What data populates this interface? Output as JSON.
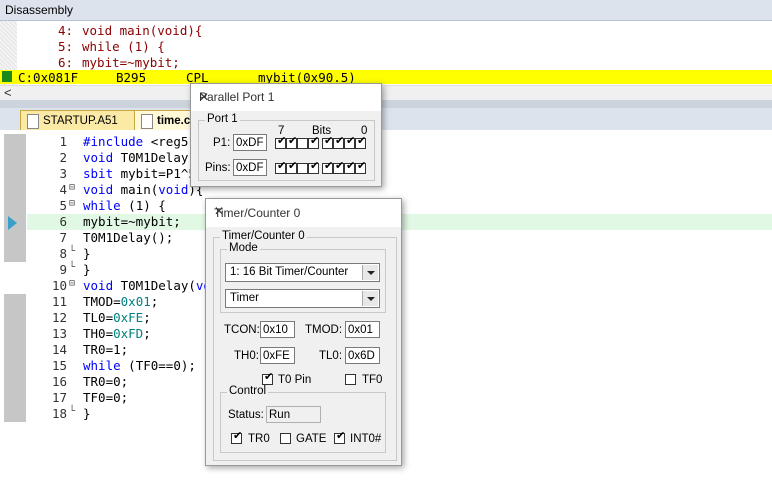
{
  "disassembly": {
    "title": "Disassembly",
    "src_lines": [
      {
        "num": "4:",
        "text": "void main(void){"
      },
      {
        "num": "5:",
        "text": "while (1) {"
      },
      {
        "num": "6:",
        "text": "mybit=~mybit;"
      }
    ],
    "asm": {
      "addr": "C:0x081F",
      "bytes": "B295",
      "mnemonic": "CPL",
      "operand": "mybit(0x90.5)"
    },
    "scroll_left": "<"
  },
  "tabs": [
    {
      "label": "STARTUP.A51"
    },
    {
      "label": "time.c"
    }
  ],
  "editor": {
    "line_numbers": [
      "1",
      "2",
      "3",
      "4",
      "5",
      "6",
      "7",
      "8",
      "9",
      "10",
      "11",
      "12",
      "13",
      "14",
      "15",
      "16",
      "17",
      "18"
    ]
  },
  "port_dialog": {
    "title": "Parallel Port 1",
    "group": "Port 1",
    "bit_hi": "7",
    "bits_label": "Bits",
    "bit_lo": "0",
    "p1_label": "P1:",
    "p1_value": "0xDF",
    "pins_label": "Pins:",
    "pins_value": "0xDF",
    "p1_bits": [
      true,
      true,
      false,
      true,
      true,
      true,
      true,
      true
    ],
    "pins_bits": [
      true,
      true,
      false,
      true,
      true,
      true,
      true,
      true
    ]
  },
  "timer_dialog": {
    "title": "Timer/Counter 0",
    "group": "Timer/Counter 0",
    "mode_group": "Mode",
    "mode_select": "1: 16 Bit Timer/Counter",
    "type_select": "Timer",
    "tcon_label": "TCON:",
    "tcon_value": "0x10",
    "tmod_label": "TMOD:",
    "tmod_value": "0x01",
    "th0_label": "TH0:",
    "th0_value": "0xFE",
    "tl0_label": "TL0:",
    "tl0_value": "0x6D",
    "t0pin_label": "T0 Pin",
    "tf0_label": "TF0",
    "control_group": "Control",
    "status_label": "Status:",
    "status_value": "Run",
    "tr0_label": "TR0",
    "gate_label": "GATE",
    "int0_label": "INT0#",
    "checks": {
      "t0pin": true,
      "tf0": false,
      "tr0": true,
      "gate": false,
      "int0": true
    }
  }
}
